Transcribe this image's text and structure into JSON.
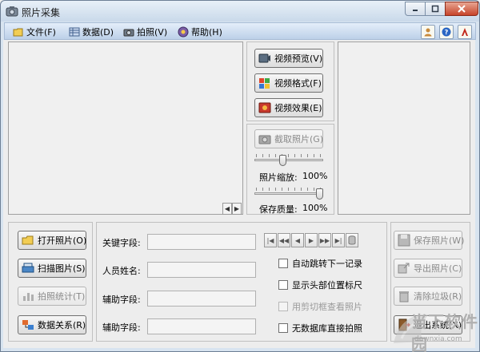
{
  "window": {
    "title": "照片采集"
  },
  "menu": [
    {
      "label": "文件(F)",
      "icon": "folder-icon"
    },
    {
      "label": "数据(D)",
      "icon": "data-icon"
    },
    {
      "label": "拍照(V)",
      "icon": "camera-icon"
    },
    {
      "label": "帮助(H)",
      "icon": "help-icon"
    }
  ],
  "toolbar_icons": [
    "user-icon",
    "help-icon",
    "adobe-icon"
  ],
  "video": {
    "preview": "视频预览(V)",
    "format": "视频格式(F)",
    "effect": "视频效果(E)",
    "capture": "截取照片(G)",
    "zoom_label": "照片缩放:",
    "zoom_value": "100%",
    "zoom_level_fraction": 0.4,
    "quality_label": "保存质量:",
    "quality_value": "100%",
    "quality_level_fraction": 1.0
  },
  "left_buttons": {
    "open": "打开照片(O)",
    "scan": "扫描图片(S)",
    "stats": "拍照统计(T)",
    "relation": "数据关系(R)"
  },
  "fields": {
    "key": "关键字段:",
    "name": "人员姓名:",
    "aux1": "辅助字段:",
    "aux2": "辅助字段:"
  },
  "options": {
    "auto_next": "自动跳转下一记录",
    "head_pos": "显示头部位置标尺",
    "crop_view": "用剪切框查看照片",
    "no_db": "无数据库直接拍照"
  },
  "right_buttons": {
    "save": "保存照片(W)",
    "export": "导出照片(C)",
    "clear": "清除垃圾(R)",
    "exit": "退出系统(X)"
  },
  "watermark": {
    "text": "当下软件园",
    "sub": "downxia.com"
  }
}
